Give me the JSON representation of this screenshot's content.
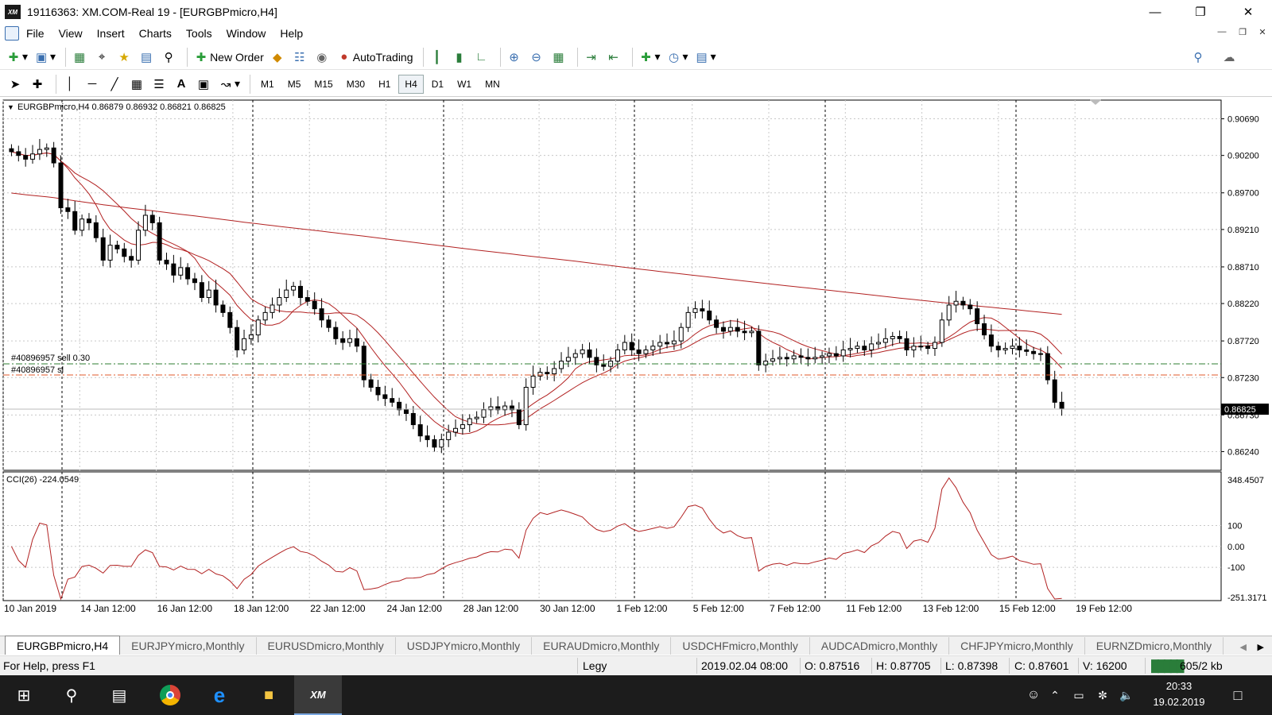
{
  "window": {
    "title": "19116363: XM.COM-Real 19 - [EURGBPmicro,H4]",
    "logo_text": "XM"
  },
  "menu": [
    "File",
    "View",
    "Insert",
    "Charts",
    "Tools",
    "Window",
    "Help"
  ],
  "toolbar": {
    "new_order": "New Order",
    "autotrading": "AutoTrading"
  },
  "timeframes": [
    "M1",
    "M5",
    "M15",
    "M30",
    "H1",
    "H4",
    "D1",
    "W1",
    "MN"
  ],
  "active_timeframe": "H4",
  "chart": {
    "header": "EURGBPmicro,H4  0.86879 0.86932 0.86821 0.86825",
    "current_price": "0.86825",
    "price_labels": [
      "0.90690",
      "0.90200",
      "0.89700",
      "0.89210",
      "0.88710",
      "0.88220",
      "0.87720",
      "0.87230",
      "0.86730",
      "0.86240"
    ],
    "order_lines": [
      "#40896957 sell 0.30",
      "#40896957 sl"
    ],
    "indicator_header": "CCI(26) -224.0549",
    "cci_labels": [
      "348.4507",
      "100",
      "0.00",
      "-100",
      "-251.3171"
    ],
    "date_labels": [
      "10 Jan 2019",
      "14 Jan 12:00",
      "16 Jan 12:00",
      "18 Jan 12:00",
      "22 Jan 12:00",
      "24 Jan 12:00",
      "28 Jan 12:00",
      "30 Jan 12:00",
      "1 Feb 12:00",
      "5 Feb 12:00",
      "7 Feb 12:00",
      "11 Feb 12:00",
      "13 Feb 12:00",
      "15 Feb 12:00",
      "19 Feb 12:00"
    ],
    "colors": {
      "bull": "#ffffff",
      "bear": "#000000",
      "ma": "#b22222",
      "sell_line": "#2e7d32",
      "sl_line": "#e05a2b"
    }
  },
  "chart_data": {
    "type": "candlestick",
    "symbol": "EURGBPmicro",
    "timeframe": "H4",
    "ylim": [
      0.8599,
      0.9094
    ],
    "close": [
      0.9025,
      0.902,
      0.9015,
      0.9022,
      0.9028,
      0.903,
      0.901,
      0.895,
      0.8945,
      0.892,
      0.8935,
      0.893,
      0.891,
      0.888,
      0.89,
      0.8895,
      0.8885,
      0.888,
      0.892,
      0.894,
      0.893,
      0.888,
      0.8875,
      0.886,
      0.887,
      0.8855,
      0.885,
      0.883,
      0.884,
      0.882,
      0.881,
      0.879,
      0.876,
      0.8775,
      0.878,
      0.88,
      0.881,
      0.882,
      0.883,
      0.884,
      0.8845,
      0.883,
      0.8825,
      0.8815,
      0.88,
      0.879,
      0.8775,
      0.877,
      0.8775,
      0.8765,
      0.872,
      0.871,
      0.87,
      0.8695,
      0.869,
      0.868,
      0.8675,
      0.866,
      0.8645,
      0.864,
      0.863,
      0.864,
      0.865,
      0.8655,
      0.866,
      0.8668,
      0.867,
      0.868,
      0.8684,
      0.868,
      0.8685,
      0.868,
      0.866,
      0.871,
      0.8725,
      0.873,
      0.8728,
      0.8735,
      0.8745,
      0.875,
      0.8755,
      0.876,
      0.875,
      0.874,
      0.8738,
      0.8745,
      0.876,
      0.877,
      0.876,
      0.8755,
      0.876,
      0.8765,
      0.877,
      0.8768,
      0.8772,
      0.879,
      0.881,
      0.8815,
      0.8812,
      0.88,
      0.879,
      0.8785,
      0.879,
      0.8785,
      0.8783,
      0.8785,
      0.874,
      0.8745,
      0.8748,
      0.875,
      0.8748,
      0.8752,
      0.875,
      0.8748,
      0.875,
      0.8752,
      0.8755,
      0.8752,
      0.876,
      0.8762,
      0.8765,
      0.876,
      0.8768,
      0.877,
      0.8775,
      0.8778,
      0.8775,
      0.876,
      0.8765,
      0.8765,
      0.8762,
      0.877,
      0.88,
      0.882,
      0.8825,
      0.882,
      0.8815,
      0.8795,
      0.878,
      0.8765,
      0.876,
      0.8762,
      0.8765,
      0.876,
      0.8758,
      0.8755,
      0.8755,
      0.872,
      0.869,
      0.8682
    ],
    "series": [
      {
        "name": "CCI(26)",
        "range": [
          -251.3171,
          348.4507
        ]
      }
    ]
  },
  "tabs": [
    "EURGBPmicro,H4",
    "EURJPYmicro,Monthly",
    "EURUSDmicro,Monthly",
    "USDJPYmicro,Monthly",
    "EURAUDmicro,Monthly",
    "USDCHFmicro,Monthly",
    "AUDCADmicro,Monthly",
    "CHFJPYmicro,Monthly",
    "EURNZDmicro,Monthly"
  ],
  "status": {
    "help": "For Help, press F1",
    "profile": "Legy",
    "datetime": "2019.02.04 08:00",
    "open": "O: 0.87516",
    "high": "H: 0.87705",
    "low": "L: 0.87398",
    "close": "C: 0.87601",
    "volume": "V: 16200",
    "traffic": "605/2 kb"
  },
  "taskbar": {
    "time": "20:33",
    "date": "19.02.2019",
    "app_label": "XM"
  }
}
